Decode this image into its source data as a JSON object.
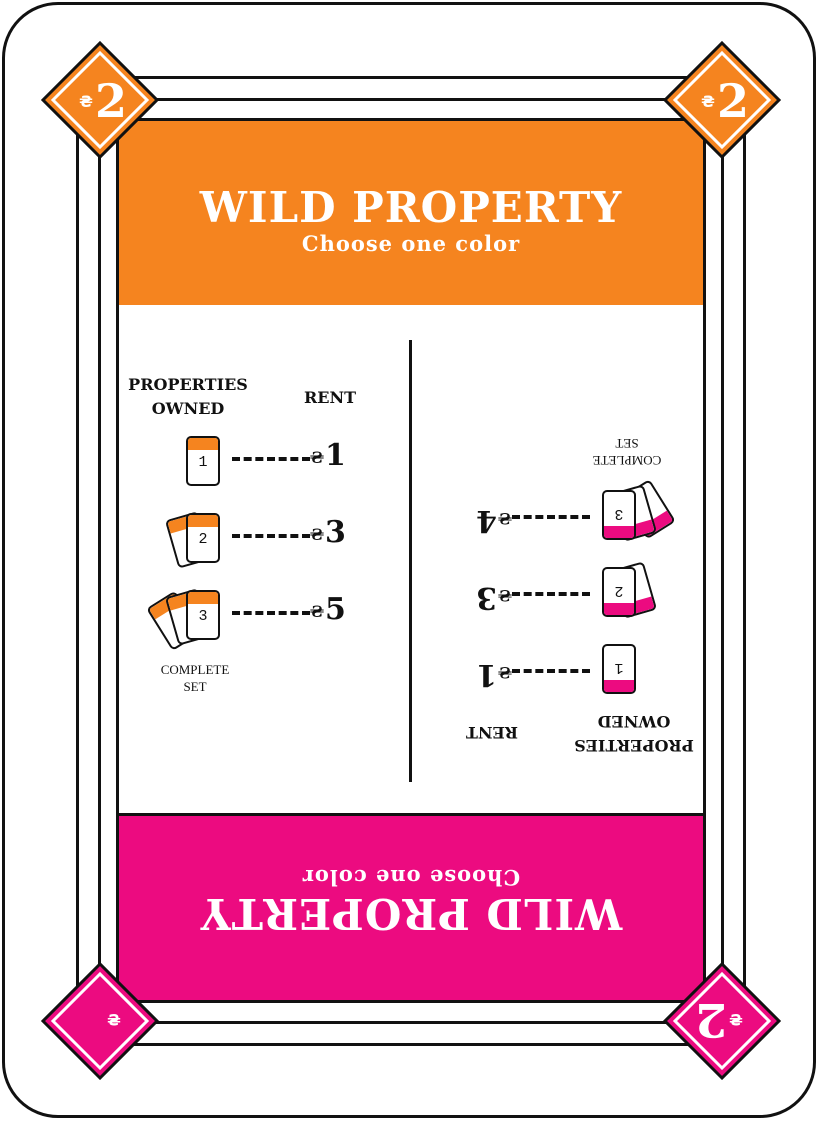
{
  "card": {
    "value": "2",
    "currency": "₴",
    "colors": {
      "top": "#f5841f",
      "bottom": "#ec0b80",
      "outline": "#111111"
    },
    "top": {
      "title": "WILD PROPERTY",
      "subtitle": "Choose one color"
    },
    "bottom": {
      "title": "WILD PROPERTY",
      "subtitle": "Choose one color"
    }
  },
  "top_table": {
    "header_owned": "PROPERTIES OWNED",
    "header_rent": "RENT",
    "rows": [
      {
        "owned": "1",
        "rent": "1"
      },
      {
        "owned": "2",
        "rent": "3"
      },
      {
        "owned": "3",
        "rent": "5"
      }
    ],
    "complete_label": "COMPLETE SET"
  },
  "bottom_table": {
    "header_owned": "PROPERTIES OWNED",
    "header_rent": "RENT",
    "rows": [
      {
        "owned": "1",
        "rent": "1"
      },
      {
        "owned": "2",
        "rent": "3"
      },
      {
        "owned": "3",
        "rent": "4"
      }
    ],
    "complete_label": "COMPLETE SET"
  }
}
